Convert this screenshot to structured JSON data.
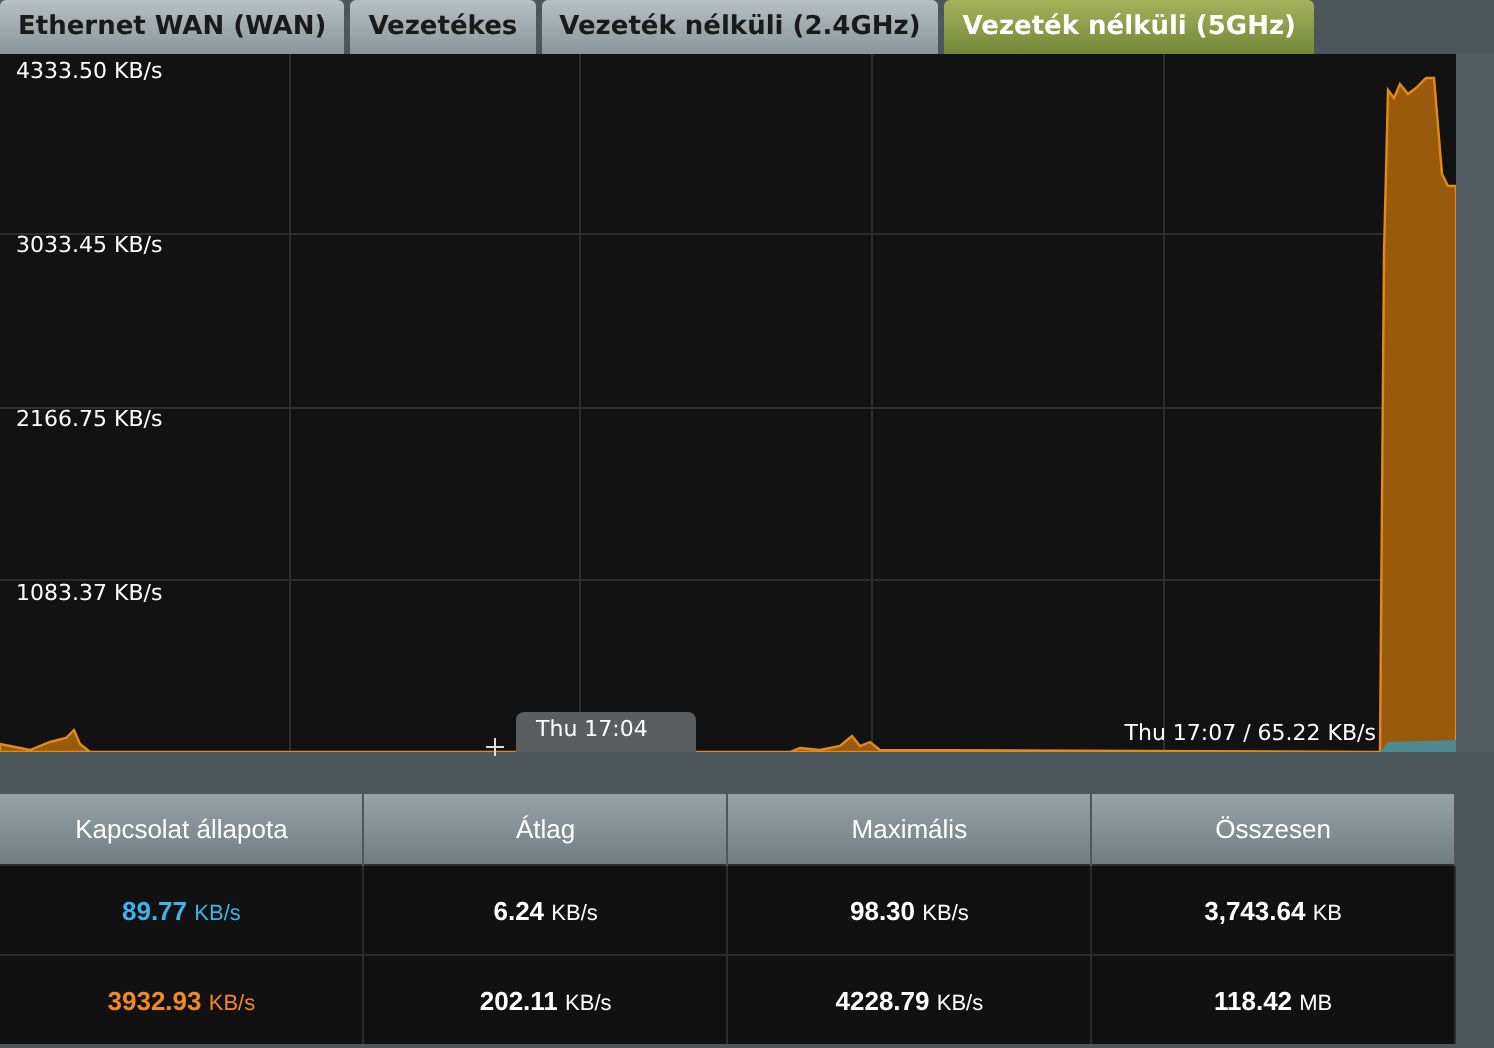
{
  "tabs": [
    {
      "label": "Ethernet WAN (WAN)",
      "selected": false
    },
    {
      "label": "Vezetékes",
      "selected": false
    },
    {
      "label": "Vezeték nélküli (2.4GHz)",
      "selected": false
    },
    {
      "label": "Vezeték nélküli (5GHz)",
      "selected": true
    }
  ],
  "graph": {
    "y_labels": [
      "4333.50 KB/s",
      "3033.45 KB/s",
      "2166.75 KB/s",
      "1083.37 KB/s"
    ],
    "tooltip": "Thu 17:04",
    "current": "Thu 17:07 / 65.22 KB/s"
  },
  "table": {
    "columns": [
      "Kapcsolat állapota",
      "Átlag",
      "Maximális",
      "Összesen"
    ],
    "rows": [
      {
        "color": "#3eb4ec",
        "cells": [
          {
            "value": "89.77",
            "unit": "KB/s"
          },
          {
            "value": "6.24",
            "unit": "KB/s"
          },
          {
            "value": "98.30",
            "unit": "KB/s"
          },
          {
            "value": "3,743.64",
            "unit": "KB"
          }
        ]
      },
      {
        "color": "#f38a1f",
        "cells": [
          {
            "value": "3932.93",
            "unit": "KB/s"
          },
          {
            "value": "202.11",
            "unit": "KB/s"
          },
          {
            "value": "4228.79",
            "unit": "KB/s"
          },
          {
            "value": "118.42",
            "unit": "MB"
          }
        ]
      }
    ]
  }
}
